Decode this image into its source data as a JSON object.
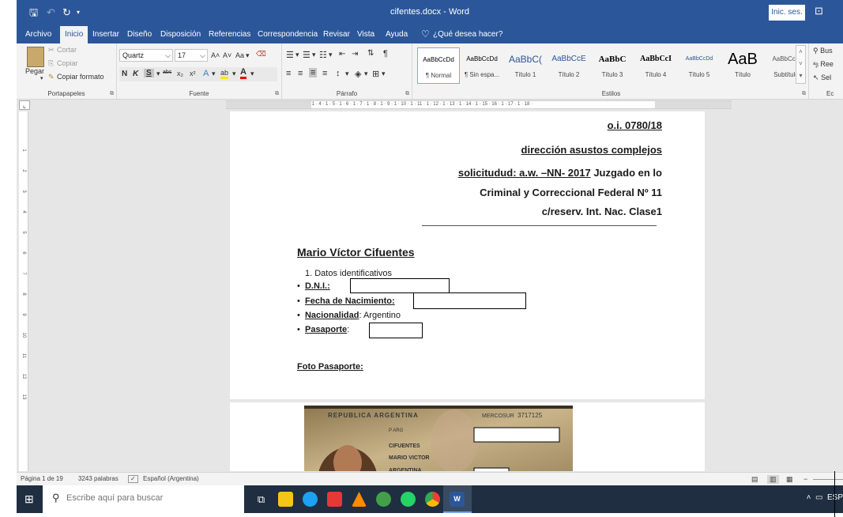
{
  "window": {
    "title": "cifentes.docx - Word",
    "sign_in": "Inic. ses."
  },
  "tabs": [
    "Archivo",
    "Inicio",
    "Insertar",
    "Diseño",
    "Disposición",
    "Referencias",
    "Correspondencia",
    "Revisar",
    "Vista",
    "Ayuda",
    "¿Qué desea hacer?"
  ],
  "ribbon": {
    "clipboard": {
      "paste": "Pegar",
      "cut": "Cortar",
      "copy": "Copiar",
      "format_painter": "Copiar formato",
      "label": "Portapapeles"
    },
    "font": {
      "name": "Quartz",
      "size": "17",
      "label": "Fuente",
      "bold": "N",
      "italic": "K",
      "underline": "S",
      "strike": "abc",
      "change_case": "Aa"
    },
    "paragraph": {
      "label": "Párrafo"
    },
    "styles": {
      "label": "Estilos",
      "items": [
        {
          "preview": "AaBbCcDd",
          "name": "¶ Normal"
        },
        {
          "preview": "AaBbCcDd",
          "name": "¶ Sin espa..."
        },
        {
          "preview": "AaBbC(",
          "name": "Título 1"
        },
        {
          "preview": "AaBbCcE",
          "name": "Título 2"
        },
        {
          "preview": "AaBbC",
          "name": "Título 3"
        },
        {
          "preview": "AaBbCcI",
          "name": "Título 4"
        },
        {
          "preview": "AaBbCcDd",
          "name": "Título 5"
        },
        {
          "preview": "AaB",
          "name": "Título"
        },
        {
          "preview": "AaBbCcD",
          "name": "Subtítulo"
        }
      ]
    },
    "editing": {
      "find": "Bus",
      "replace": "Ree",
      "select": "Sel",
      "label": "Ec"
    }
  },
  "ruler": {
    "horizontal": "3 · 1 · 2 · 1 · 1 · 1 ·   · 1 · 1 · 1 · 2 · 1 · 3 · 1 · 4 · 1 · 5 · 1 · 6 · 1 · 7 · 1 · 8 · 1 · 9 · 1 · 10 · 1 · 11 · 1 · 12 · 1 · 13 · 1 · 14 · 1 · 15 · 16 · 1 · 17 · 1 · 18 ·",
    "vertical": [
      "1",
      "2",
      "3",
      "4",
      "5",
      "6",
      "7",
      "8",
      "9",
      "10",
      "11",
      "12",
      "13"
    ]
  },
  "document": {
    "ref": "o.i. 0780/18",
    "office": "dirección asustos complejos",
    "request_label": "solicitudud: a.w. –NN- 2017",
    "request_court": " Juzgado en lo",
    "line2": "Criminal y Correccional Federal Nº 11",
    "line3": "c/reserv. Int. Nac. Clase1",
    "name": "Mario Víctor Cifuentes",
    "section": "1.   Datos identificativos",
    "fields": [
      {
        "label": "D.N.I.:",
        "value": ""
      },
      {
        "label": "Fecha de Nacimiento:",
        "value": ""
      },
      {
        "label": "Nacionalidad",
        "value": ": Argentino"
      },
      {
        "label": "Pasaporte",
        "value": ":"
      }
    ],
    "photo_heading": "Foto Pasaporte:",
    "passport": {
      "country": "REPUBLICA ARGENTINA",
      "union": "MERCOSUR",
      "number": "3717125",
      "surname": "CIFUENTES",
      "given_names": "MARIO VICTOR",
      "nationality": "ARGENTINA",
      "type": "P",
      "country_code": "ARG"
    }
  },
  "status": {
    "page": "Página 1 de 19",
    "words": "3243 palabras",
    "language": "Español (Argentina)"
  },
  "taskbar": {
    "search_placeholder": "Escribe aquí para buscar",
    "tray_lang": "ESP"
  },
  "colors": {
    "word_blue": "#2b579a",
    "taskbar": "#1f2e41"
  }
}
